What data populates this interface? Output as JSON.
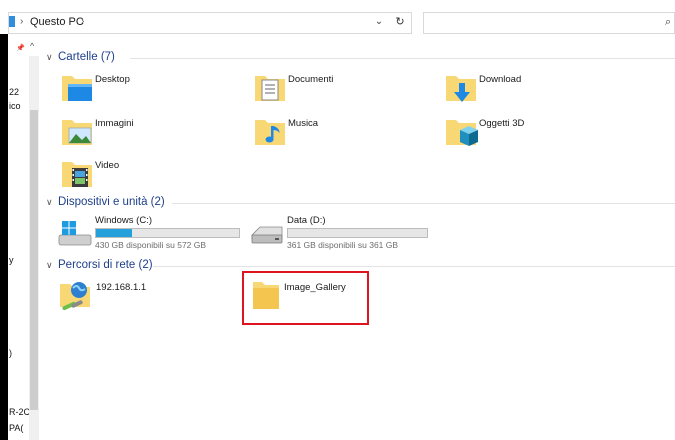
{
  "address_bar": {
    "breadcrumb_sep": "›",
    "location": "Questo PC",
    "trailing_sep": "›",
    "dropdown_glyph": "⌄",
    "refresh_glyph": "↻",
    "search_glyph": "⌕"
  },
  "nav_pane": {
    "pin_glyph": "📌",
    "up_glyph": "^",
    "fragments": [
      "22",
      "ico",
      "y",
      ")",
      "R-2C",
      "PA("
    ]
  },
  "groups": [
    {
      "name": "Cartelle (7)",
      "chevron": "∨"
    },
    {
      "name": "Dispositivi e unità (2)",
      "chevron": "∨"
    },
    {
      "name": "Percorsi di rete (2)",
      "chevron": "∨"
    }
  ],
  "folders": [
    "Desktop",
    "Documenti",
    "Download",
    "Immagini",
    "Musica",
    "Oggetti 3D",
    "Video"
  ],
  "drives": [
    {
      "label": "Windows (C:)",
      "space": "430 GB disponibili su 572 GB",
      "used_fraction": 0.25
    },
    {
      "label": "Data (D:)",
      "space": "361 GB disponibili su 361 GB",
      "used_fraction": 0.0
    }
  ],
  "network": [
    "192.168.1.1",
    "Image_Gallery"
  ],
  "colors": {
    "accent": "#26a0da",
    "group_header": "#1e3f8a",
    "highlight": "#e0141e",
    "folder": "#f4c650"
  },
  "icons": {
    "desktop": "desktop-folder-icon",
    "documents": "documents-folder-icon",
    "downloads": "downloads-folder-icon",
    "pictures": "pictures-folder-icon",
    "music": "music-folder-icon",
    "objects3d": "3d-objects-folder-icon",
    "videos": "videos-folder-icon",
    "windows_drive": "windows-drive-icon",
    "data_drive": "hard-drive-icon",
    "network_location": "network-location-icon",
    "network_folder": "network-folder-icon"
  }
}
